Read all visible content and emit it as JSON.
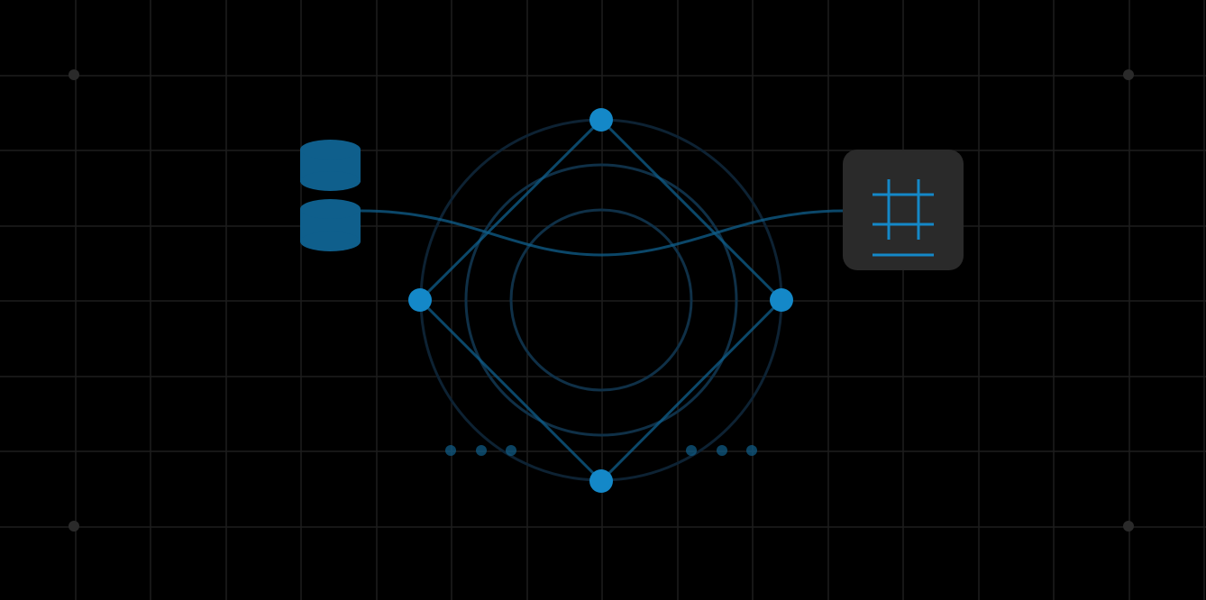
{
  "colors": {
    "background": "#000000",
    "grid_line": "#1d1d1d",
    "grid_dot": "#2a2a2a",
    "accent": "#1488c8",
    "accent_dim": "#0f5f8c",
    "ring_faint": "#0d2233",
    "ring_mid": "#0f3047",
    "tile_background": "#2a2a2a"
  },
  "icons": {
    "left": "database-icon",
    "right": "grid-table-icon"
  },
  "dot_groups": {
    "left_count": 3,
    "right_count": 3
  }
}
